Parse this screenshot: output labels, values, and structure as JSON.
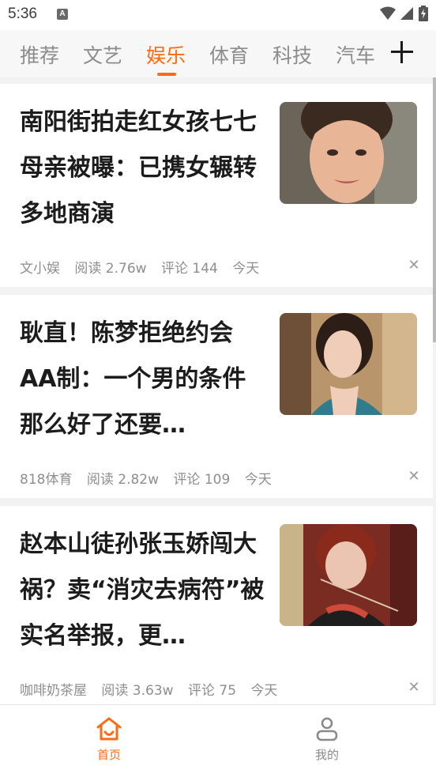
{
  "status_bar": {
    "time": "5:36",
    "notification_icon": "A"
  },
  "tabs": [
    {
      "label": "推荐",
      "active": false
    },
    {
      "label": "文艺",
      "active": false
    },
    {
      "label": "娱乐",
      "active": true
    },
    {
      "label": "体育",
      "active": false
    },
    {
      "label": "科技",
      "active": false
    },
    {
      "label": "汽车",
      "active": false
    }
  ],
  "articles": [
    {
      "title": "南阳街拍走红女孩七七母亲被曝：已携女辗转多地商演",
      "source": "文小娱",
      "reads": "阅读 2.76w",
      "comments": "评论 144",
      "time": "今天"
    },
    {
      "title": "耿直！陈梦拒绝约会AA制：一个男的条件那么好了还要…",
      "source": "818体育",
      "reads": "阅读 2.82w",
      "comments": "评论 109",
      "time": "今天"
    },
    {
      "title": "赵本山徒孙张玉娇闯大祸？卖“消灾去病符”被实名举报，更…",
      "source": "咖啡奶茶屋",
      "reads": "阅读 3.63w",
      "comments": "评论 75",
      "time": "今天"
    }
  ],
  "bottom_nav": {
    "home_label": "首页",
    "me_label": "我的"
  },
  "colors": {
    "accent": "#ff6a13"
  }
}
